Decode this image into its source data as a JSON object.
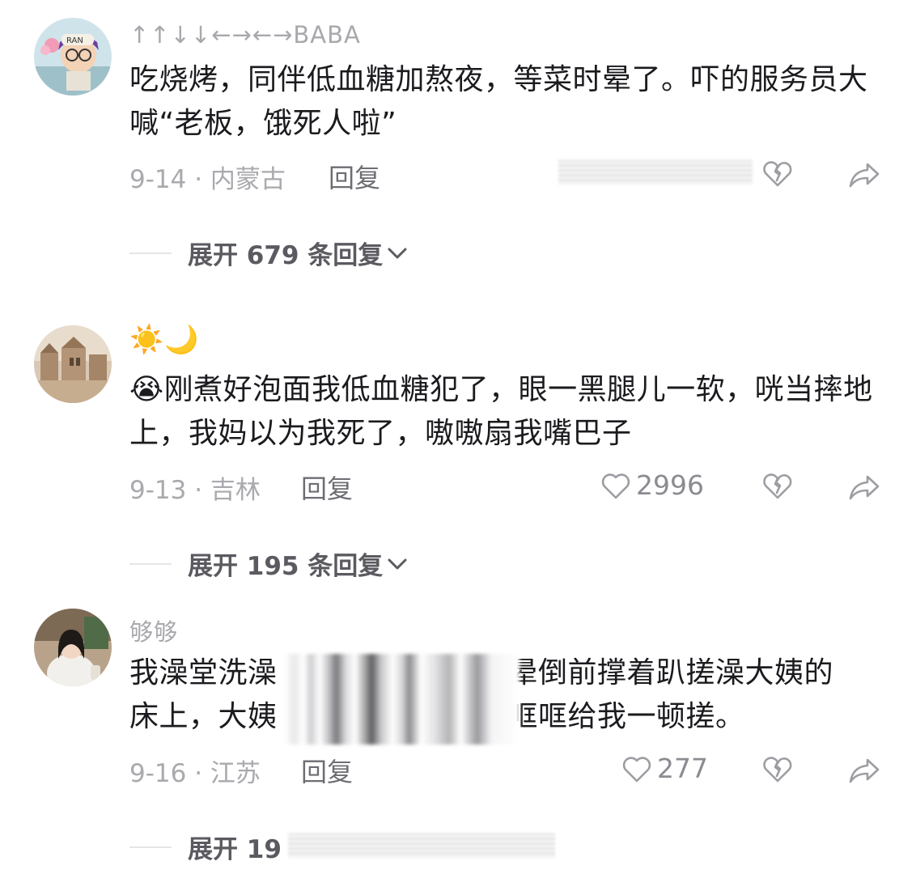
{
  "comments": [
    {
      "username": "↑↑↓↓←→←→BABA",
      "text": "吃烧烤，同伴低血糖加熬夜，等菜时晕了。吓的服务员大喊“老板，饿死人啦”",
      "date_location": "9-14 · 内蒙古",
      "reply_label": "回复",
      "like_count": "",
      "expand_label": "展开 679 条回复"
    },
    {
      "username": "☀️🌙",
      "text": "😭刚煮好泡面我低血糖犯了，眼一黑腿儿一软，咣当摔地上，我妈以为我死了，嗷嗷扇我嘴巴子",
      "date_location": "9-13 · 吉林",
      "reply_label": "回复",
      "like_count": "2996",
      "expand_label": "展开 195 条回复"
    },
    {
      "username": "够够",
      "text_line1": "我澡堂洗澡",
      "text_line1_end": "晕倒前撑着趴搓澡大姨的",
      "text_line2": "床上，大姨",
      "text_line2_end": "哐哐给我一顿搓。",
      "date_location": "9-16 · 江苏",
      "reply_label": "回复",
      "like_count": "277",
      "expand_label": "展开 19"
    }
  ],
  "icons": {
    "like": "heart-outline-icon",
    "dislike": "broken-heart-icon",
    "share": "share-arrow-icon",
    "expand": "chevron-down-icon"
  },
  "colors": {
    "text": "#1b1b1f",
    "meta": "#a9a9ae",
    "expand": "#5a5a60"
  }
}
